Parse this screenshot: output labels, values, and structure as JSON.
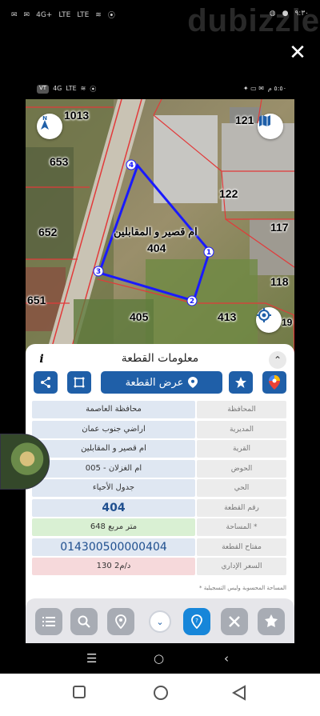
{
  "outer_status": {
    "time": "٩:٣٠",
    "network": "4G+",
    "lte1": "LTE",
    "lte2": "LTE"
  },
  "watermark": "dubizzle",
  "inner_status": {
    "time": "٥:٥٠ م",
    "network": "4G",
    "lte": "LTE"
  },
  "map": {
    "labels": {
      "p1013": "1013",
      "p121": "121",
      "p653": "653",
      "p122": "122",
      "p652": "652",
      "p117": "117",
      "p651": "651",
      "p118": "118",
      "p404": "404",
      "p405": "405",
      "p413": "413",
      "p19": "19",
      "area_name": "ام قصير و المقابلين"
    },
    "vertices": [
      "4",
      "1",
      "3",
      "2"
    ],
    "parcel_color": "#1a1aff"
  },
  "sheet": {
    "title": "معلومات القطعة",
    "show_parcel": "عرض القطعة",
    "rows": [
      {
        "label": "المحافظة",
        "value": "محافظة العاصمة"
      },
      {
        "label": "المديرية",
        "value": "اراضي جنوب عمان"
      },
      {
        "label": "القرية",
        "value": "ام قصير و المقابلين"
      },
      {
        "label": "الحوض",
        "value": "ام الغزلان - 005"
      },
      {
        "label": "الحي",
        "value": "جدول الأحياء"
      },
      {
        "label": "رقم القطعة",
        "value": "404"
      },
      {
        "label": "المساحة *",
        "value": "648 متر مربع"
      },
      {
        "label": "مفتاح القطعة",
        "value": "014300500000404"
      },
      {
        "label": "السعر الإداري",
        "value": "130 د/م2"
      }
    ],
    "note": "* المساحة المحسوبة وليس التسجيلية"
  },
  "colors": {
    "accent": "#1f5fa8",
    "active": "#1786d9",
    "parcel": "#1a1aff"
  }
}
